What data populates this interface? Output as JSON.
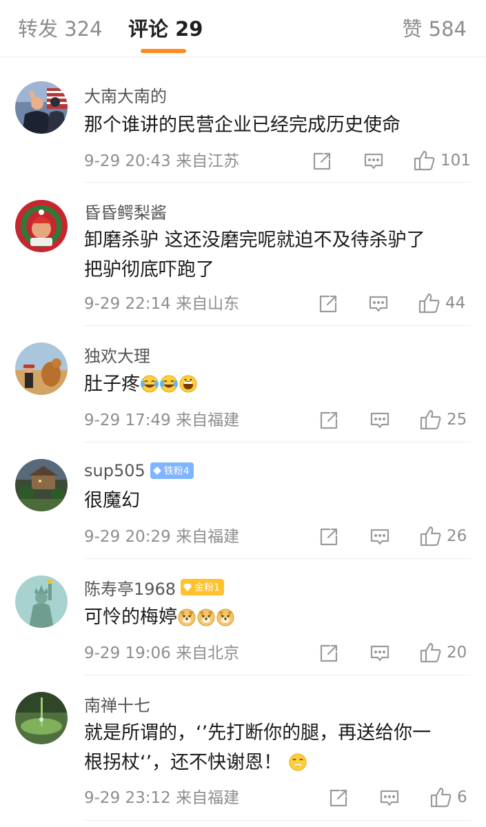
{
  "tabs": {
    "repost": "转发 324",
    "comments": "评论 29",
    "likes": "赞 584"
  },
  "colors": {
    "accent": "#ff8a1f",
    "fan_badge_blue": "#7fb4ff",
    "fan_badge_gold": "#ffc12d"
  },
  "comments": [
    {
      "name": "大南大南的",
      "badge": "",
      "text": [
        "那个谁讲的民营企业已经完成历史使命"
      ],
      "time": "9-29 20:43",
      "location": "来自江苏",
      "likes": "101"
    },
    {
      "name": "昏昏鳄梨酱",
      "badge": "",
      "text": [
        "卸磨杀驴 这还没磨完呢就迫不及待杀驴了",
        "把驴彻底吓跑了"
      ],
      "time": "9-29 22:14",
      "location": "来自山东",
      "likes": "44"
    },
    {
      "name": "独欢大理",
      "badge": "",
      "text": [
        "肚子疼"
      ],
      "emoji": "laughing-crying x2, grinning",
      "time": "9-29 17:49",
      "location": "来自福建",
      "likes": "25"
    },
    {
      "name": "sup505",
      "badge": "铁粉4",
      "text": [
        "很魔幻"
      ],
      "time": "9-29 20:29",
      "location": "来自福建",
      "likes": "26"
    },
    {
      "name": "陈寿亭1968",
      "badge": "金粉1",
      "text": [
        "可怜的梅婷"
      ],
      "emoji": "doge x3",
      "time": "9-29 19:06",
      "location": "来自北京",
      "likes": "20"
    },
    {
      "name": "南禅十七",
      "badge": "",
      "text": [
        "就是所谓的，‘’先打断你的腿，再送给你一",
        "根拐杖‘’，还不快谢恩！"
      ],
      "emoji": "smirk",
      "time": "9-29 23:12",
      "location": "来自福建",
      "likes": "6"
    }
  ]
}
